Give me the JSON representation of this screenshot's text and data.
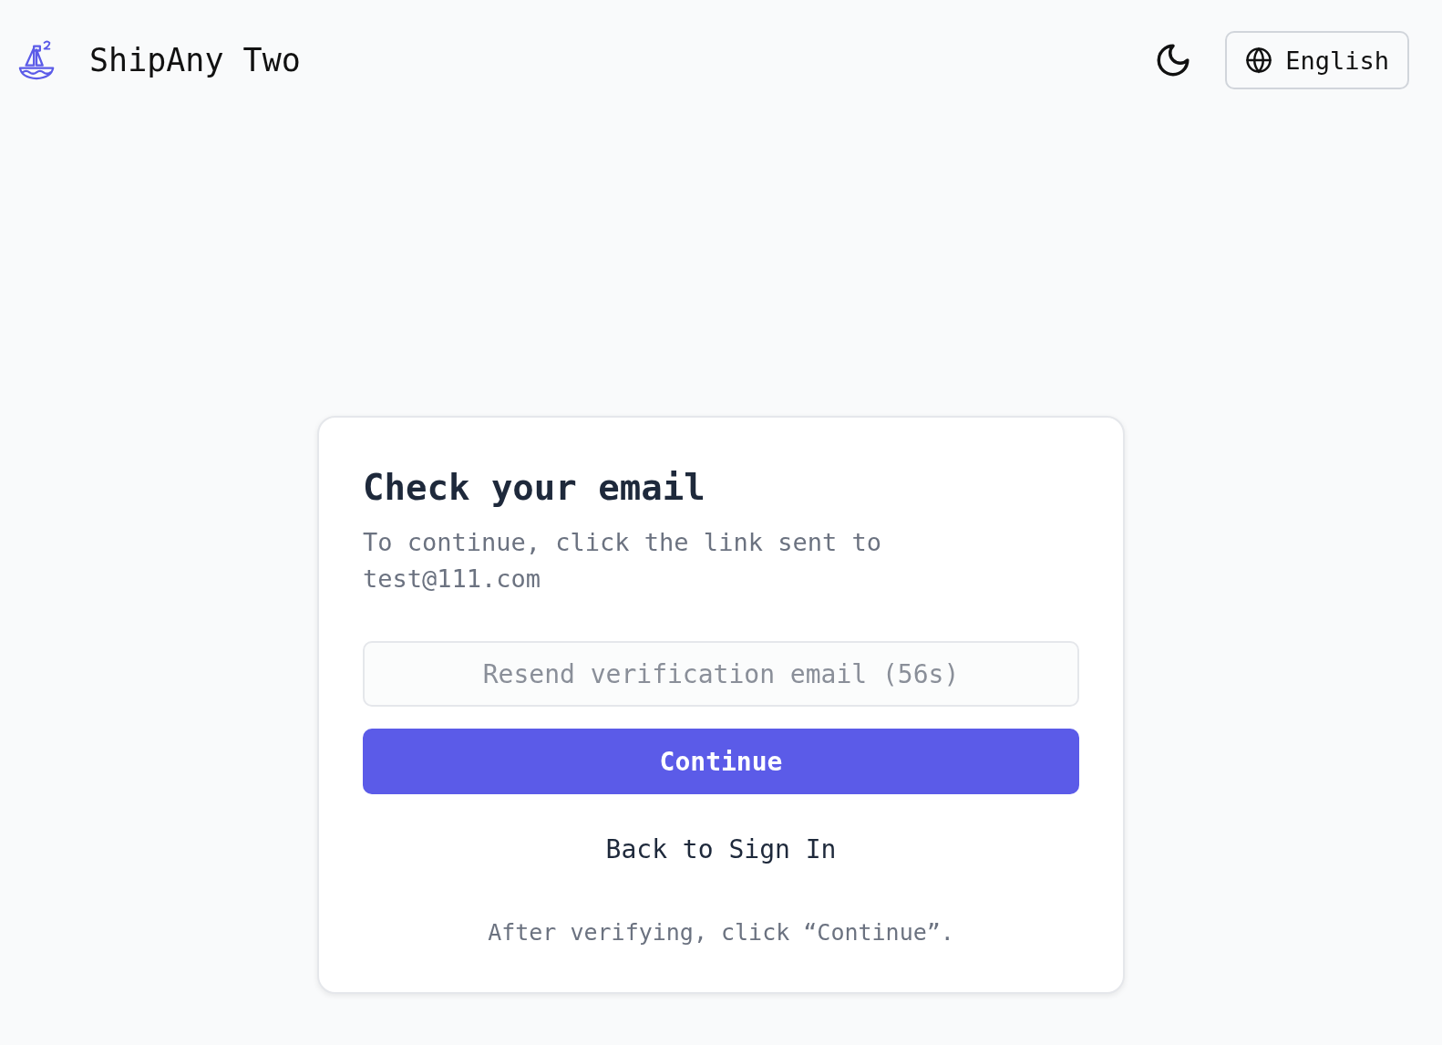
{
  "header": {
    "brand": "ShipAny Two",
    "language": "English"
  },
  "card": {
    "title": "Check your email",
    "message": "To continue, click the link sent to test@111.com",
    "resend_button": {
      "label": "Resend verification email (56s)",
      "disabled": true
    },
    "continue_button": {
      "label": "Continue"
    },
    "back_link": "Back to Sign In",
    "note": "After verifying, click “Continue”."
  }
}
